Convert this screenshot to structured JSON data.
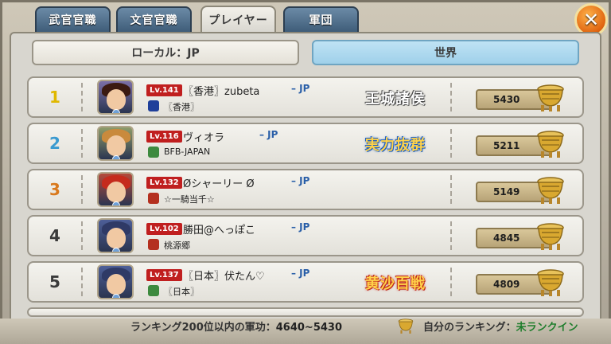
{
  "tabs": [
    {
      "label": "武官官職"
    },
    {
      "label": "文官官職"
    },
    {
      "label": "プレイヤー"
    },
    {
      "label": "軍団"
    }
  ],
  "active_tab": "プレイヤー",
  "close_icon": "close-x-icon",
  "toggles": {
    "local": "ローカル：JP",
    "world": "世界"
  },
  "active_toggle": "世界",
  "rows": [
    {
      "rank": "1",
      "rank_color": "#e0b800",
      "level": "Lv.141",
      "name": "〖香港〗zubeta",
      "server": "– JP",
      "guild": "〖香港〗",
      "title": "王城諸侯",
      "score": "5430",
      "hair": "#3b1a12",
      "bg": "#7b6fa8",
      "guild_color": "#1f3f9a"
    },
    {
      "rank": "2",
      "rank_color": "#3a9ad0",
      "level": "Lv.116",
      "name": "ヴィオラ",
      "server": "– JP",
      "guild": "BFB-JAPAN",
      "title": "実力抜群",
      "score": "5211",
      "hair": "#c98a3d",
      "bg": "#8e9c6a",
      "guild_color": "#3d8a3f"
    },
    {
      "rank": "3",
      "rank_color": "#d9791d",
      "level": "Lv.132",
      "name": "Øシャーリー Ø",
      "server": "– JP",
      "guild": "☆一騎当千☆",
      "title": "",
      "score": "5149",
      "hair": "#c52b1d",
      "bg": "#b54a3a",
      "guild_color": "#b4301f"
    },
    {
      "rank": "4",
      "rank_color": "#3a3a3a",
      "level": "Lv.102",
      "name": "勝田@へっぽこ",
      "server": "– JP",
      "guild": "桃源郷",
      "title": "",
      "score": "4845",
      "hair": "#2f3a66",
      "bg": "#4d5f98",
      "guild_color": "#b4301f"
    },
    {
      "rank": "5",
      "rank_color": "#3a3a3a",
      "level": "Lv.137",
      "name": "〖日本〗伏たん♡",
      "server": "– JP",
      "guild": "〖日本〗",
      "title": "黄沙百戦",
      "score": "4809",
      "hair": "#2f3a66",
      "bg": "#4d5f98",
      "guild_color": "#3d8a3f"
    }
  ],
  "footer": {
    "range_label": "ランキング200位以内の軍功：",
    "range_value": "4640~5430",
    "my_label": "自分のランキング：",
    "my_value": "未ランクイン"
  }
}
